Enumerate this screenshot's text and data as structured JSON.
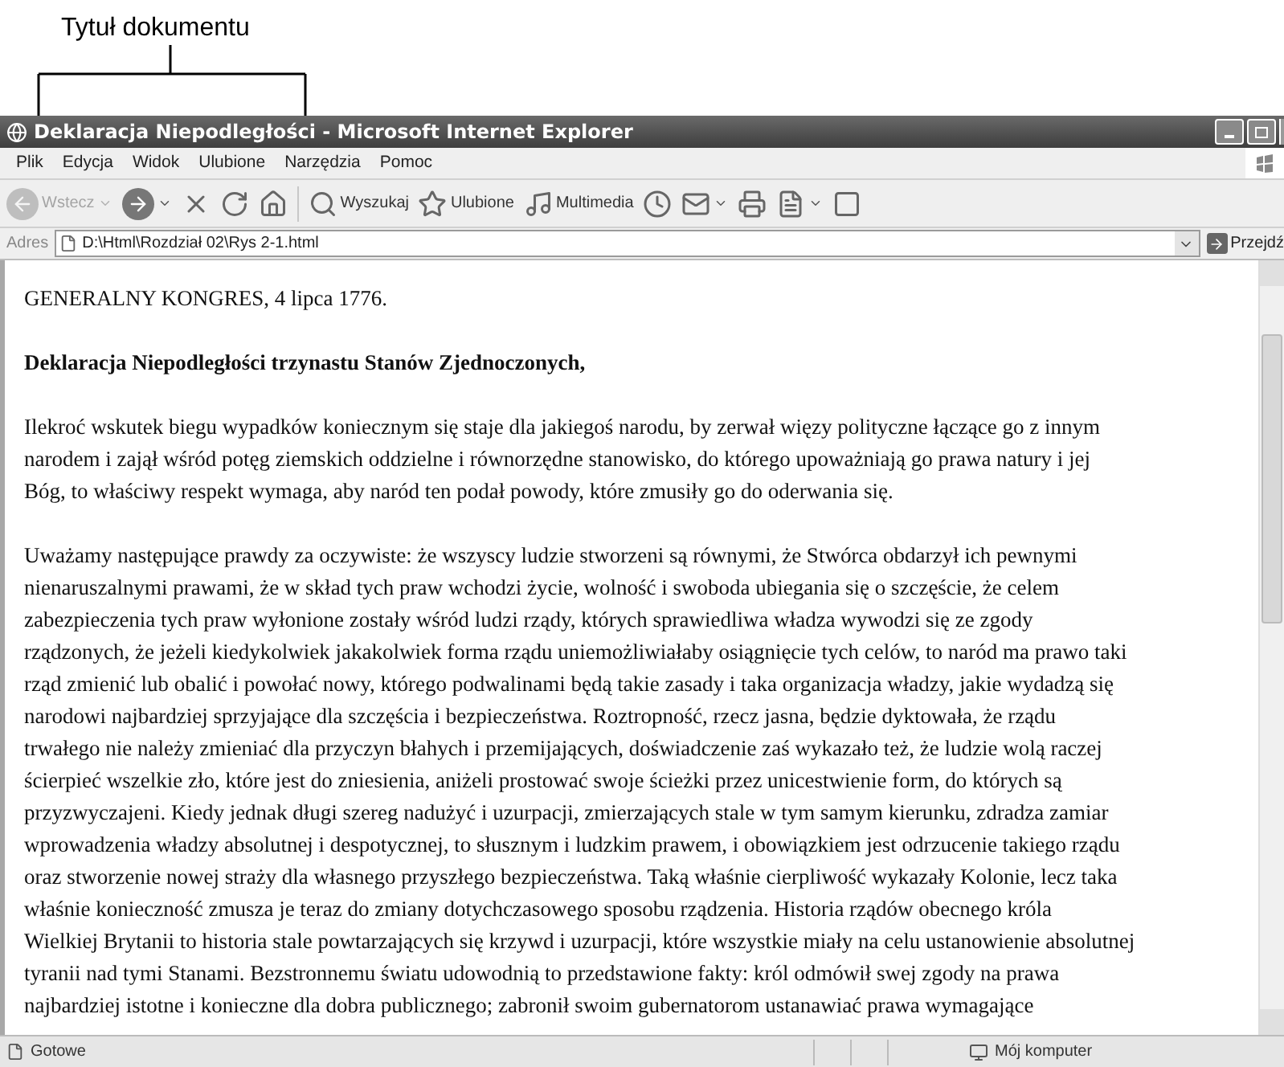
{
  "callout": {
    "label": "Tytuł dokumentu"
  },
  "window": {
    "title": "Deklaracja Niepodległości - Microsoft Internet Explorer"
  },
  "menu": [
    "Plik",
    "Edycja",
    "Widok",
    "Ulubione",
    "Narzędzia",
    "Pomoc"
  ],
  "toolbar": [
    {
      "kind": "back",
      "label": "Wstecz",
      "disabled": true,
      "menu": true
    },
    {
      "kind": "forward",
      "disabled": false,
      "menu": true
    },
    {
      "kind": "stop",
      "disabled": false,
      "menu": false
    },
    {
      "kind": "refresh",
      "disabled": false,
      "menu": false
    },
    {
      "kind": "home",
      "disabled": false,
      "menu": false
    },
    {
      "kind": "search",
      "label": "Wyszukaj",
      "disabled": false,
      "menu": false
    },
    {
      "kind": "favorites",
      "label": "Ulubione",
      "disabled": false,
      "menu": false
    },
    {
      "kind": "media",
      "label": "Multimedia",
      "disabled": false,
      "menu": false
    },
    {
      "kind": "history",
      "disabled": false,
      "menu": false
    },
    {
      "kind": "mail",
      "disabled": false,
      "menu": true
    },
    {
      "kind": "print",
      "disabled": false,
      "menu": false
    },
    {
      "kind": "word",
      "disabled": false,
      "menu": true
    },
    {
      "kind": "blank",
      "disabled": false,
      "menu": false
    }
  ],
  "address": {
    "label": "Adres",
    "value": "D:\\Html\\Rozdział 02\\Rys 2-1.html",
    "go": "Przejdź"
  },
  "content": {
    "dateline": "GENERALNY KONGRES, 4 lipca 1776.",
    "heading": "Deklaracja Niepodległości trzynastu Stanów Zjednoczonych,",
    "paragraphs": [
      [
        "Ilekroć wskutek biegu wypadków koniecznym się staje dla jakiegoś narodu, by zerwał więzy polityczne łączące go z innym",
        "narodem i zajął wśród potęg ziemskich oddzielne i równorzędne stanowisko, do którego upoważniają go prawa natury i jej",
        "Bóg, to właściwy respekt wymaga, aby naród ten podał powody, które zmusiły go do oderwania się."
      ],
      [
        "Uważamy następujące prawdy za oczywiste: że wszyscy ludzie stworzeni są równymi, że Stwórca obdarzył ich pewnymi",
        "nienaruszalnymi prawami, że w skład tych praw wchodzi życie, wolność i swoboda ubiegania się o szczęście, że celem",
        "zabezpieczenia tych praw wyłonione zostały wśród ludzi rządy, których sprawiedliwa władza wywodzi się ze zgody",
        "rządzonych, że jeżeli kiedykolwiek jakakolwiek forma rządu uniemożliwiałaby osiągnięcie tych celów, to naród ma prawo taki",
        "rząd zmienić lub obalić i powołać nowy, którego podwalinami będą takie zasady i taka organizacja władzy, jakie wydadzą się",
        "narodowi najbardziej sprzyjające dla szczęścia i bezpieczeństwa. Roztropność, rzecz jasna, będzie dyktowała, że rządu",
        "trwałego nie należy zmieniać dla przyczyn błahych i przemijających, doświadczenie zaś wykazało też, że ludzie wolą raczej",
        "ścierpieć wszelkie zło, które jest do zniesienia, aniżeli prostować swoje ścieżki przez unicestwienie form, do których są",
        "przyzwyczajeni. Kiedy jednak długi szereg nadużyć i uzurpacji, zmierzających stale w tym samym kierunku, zdradza zamiar",
        "wprowadzenia władzy absolutnej i despotycznej, to słusznym i ludzkim prawem, i obowiązkiem jest odrzucenie takiego rządu",
        "oraz stworzenie nowej straży dla własnego przyszłego bezpieczeństwa. Taką właśnie cierpliwość wykazały Kolonie, lecz taka",
        "właśnie konieczność zmusza je teraz do zmiany dotychczasowego sposobu rządzenia. Historia rządów obecnego króla",
        "Wielkiej Brytanii to historia stale powtarzających się krzywd i uzurpacji, które wszystkie miały na celu ustanowienie absolutnej",
        "tyranii nad tymi Stanami. Bezstronnemu światu udowodnią to przedstawione fakty: król odmówił swej zgody na prawa",
        "najbardziej istotne i konieczne dla dobra publicznego; zabronił swoim gubernatorom ustanawiać prawa wymagające"
      ]
    ]
  },
  "status_bar": {
    "text": "Gotowe",
    "zone": "Mój komputer"
  }
}
